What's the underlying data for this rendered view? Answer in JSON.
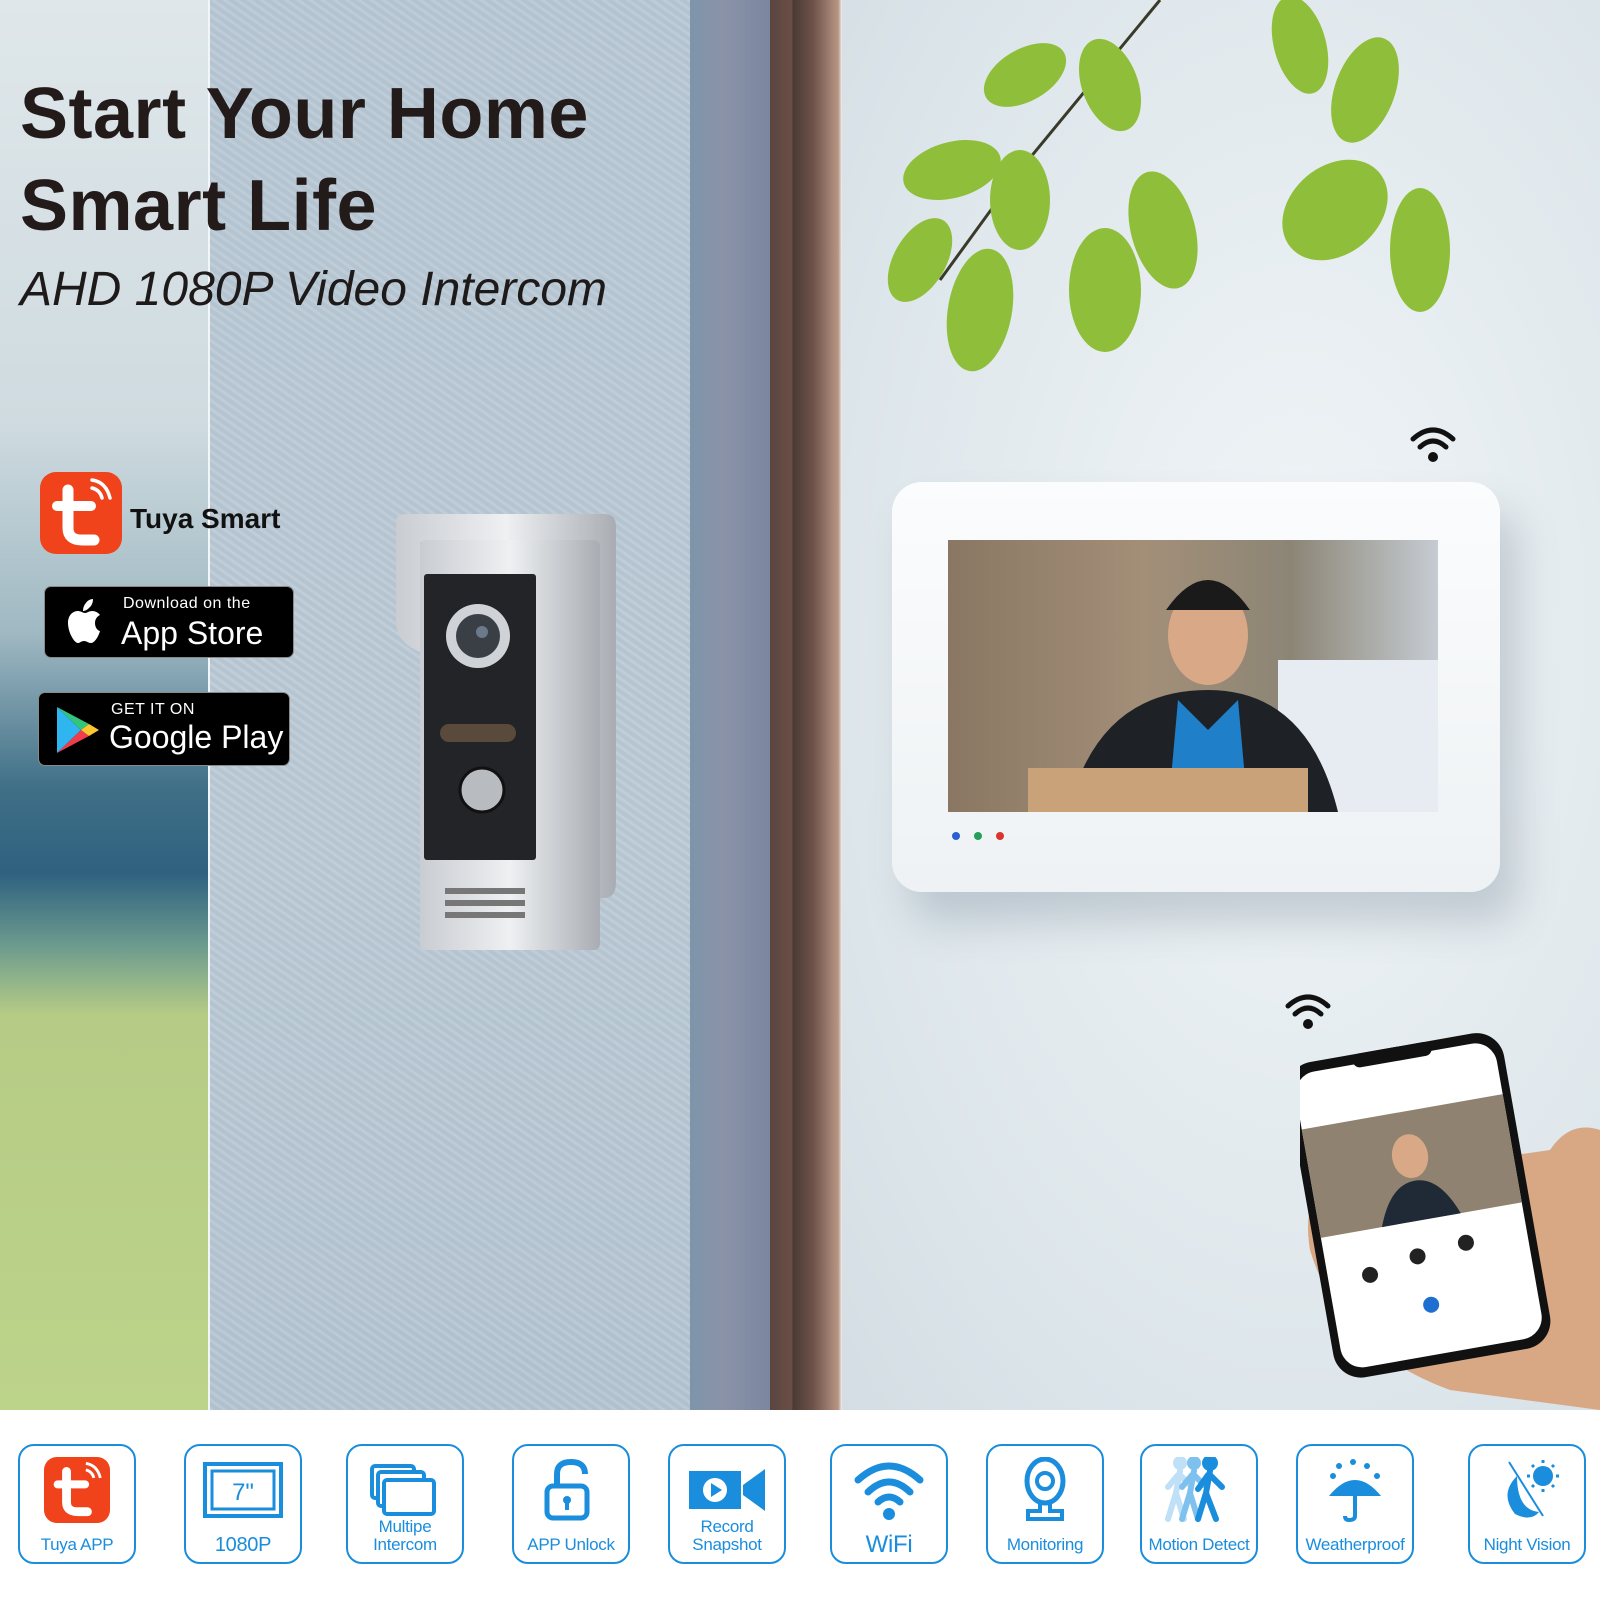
{
  "headline": {
    "line1": "Start Your Home",
    "line2": "Smart Life"
  },
  "subheadline": "AHD 1080P Video Intercom",
  "app": {
    "name": "Tuya Smart",
    "logo_icon": "tuya-app-icon"
  },
  "stores": {
    "apple": {
      "small": "Download on the",
      "big": "App Store",
      "icon": "apple-icon"
    },
    "google": {
      "small": "GET IT ON",
      "big": "Google Play",
      "icon": "google-play-icon"
    }
  },
  "products": {
    "outdoor_unit": "doorbell-camera",
    "indoor_monitor": "7-inch-monitor",
    "mobile": "smartphone-app-view"
  },
  "colors": {
    "accent": "#1a8ddd",
    "tuya": "#f0421b",
    "headline": "#231a1a"
  },
  "features": [
    {
      "label": "Tuya APP",
      "icon": "tuya-app-icon"
    },
    {
      "label": "1080P",
      "icon": "screen-7inch-icon",
      "screen_size": "7\""
    },
    {
      "label": "Multipe Intercom",
      "icon": "multiple-screens-icon"
    },
    {
      "label": "APP Unlock",
      "icon": "unlock-icon"
    },
    {
      "label": "Record Snapshot",
      "icon": "video-camera-icon"
    },
    {
      "label": "WiFi",
      "icon": "wifi-icon"
    },
    {
      "label": "Monitoring",
      "icon": "webcam-icon"
    },
    {
      "label": "Motion Detect",
      "icon": "walking-person-icon"
    },
    {
      "label": "Weatherproof",
      "icon": "umbrella-rain-icon"
    },
    {
      "label": "Night Vision",
      "icon": "moon-sun-icon"
    }
  ]
}
